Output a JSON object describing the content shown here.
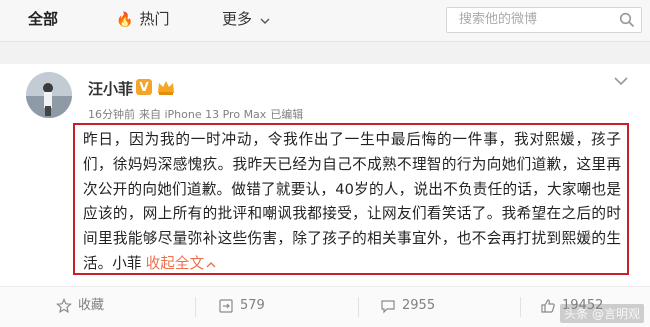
{
  "topbar": {
    "tab_all": "全部",
    "tab_hot": "热门",
    "tab_more": "更多",
    "search_placeholder": "搜索他的微博"
  },
  "post": {
    "author": "汪小菲",
    "verified_badge": "V",
    "meta": {
      "time": "16分钟前",
      "source": "来自 iPhone 13 Pro Max",
      "edited": "已编辑"
    },
    "content": "昨日，因为我的一时冲动，令我作出了一生中最后悔的一件事，我对熙媛，孩子们，徐妈妈深感愧疚。我昨天已经为自己不成熟不理智的行为向她们道歉，这里再次公开的向她们道歉。做错了就要认，40岁的人，说出不负责任的话，大家嘲也是应该的，网上所有的批评和嘲讽我都接受，让网友们看笑话了。我希望在之后的时间里我能够尽量弥补这些伤害，除了孩子的相关事宜外，也不会再打扰到熙媛的生活。小菲",
    "collapse_label": "收起全文"
  },
  "actions": {
    "favorite": "收藏",
    "repost_count": "579",
    "comment_count": "2955",
    "like_count": "19452"
  },
  "watermark": "头条 @言明观",
  "colors": {
    "accent_link": "#eb7350",
    "highlight_border": "#c8202b",
    "hot_flame": "#ff7800",
    "v_badge": "#f3a42a"
  }
}
